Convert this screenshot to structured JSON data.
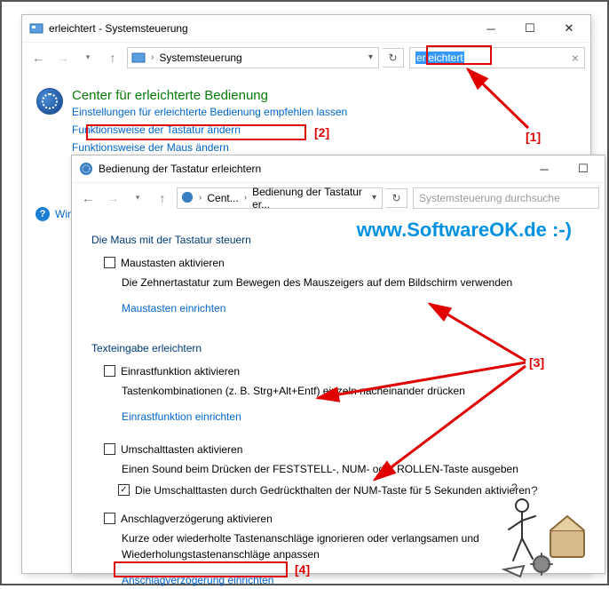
{
  "watermark": "www.SoftwareOK.de :-)",
  "window1": {
    "title": "erleichtert - Systemsteuerung",
    "breadcrumb": "Systemsteuerung",
    "search_value": "erleichtert",
    "heading": "Center für erleichterte Bedienung",
    "link_recommend": "Einstellungen für erleichterte Bedienung empfehlen lassen",
    "link_keyboard": "Funktionsweise der Tastatur ändern",
    "link_mouse": "Funktionsweise der Maus ändern",
    "help_link": "Windo"
  },
  "window2": {
    "title": "Bedienung der Tastatur erleichtern",
    "breadcrumb1": "Cent...",
    "breadcrumb2": "Bedienung der Tastatur er...",
    "search_placeholder": "Systemsteuerung durchsuche",
    "sec_mouse_title": "Die Maus mit der Tastatur steuern",
    "cb_mousekeys": "Maustasten aktivieren",
    "desc_mousekeys": "Die Zehnertastatur zum Bewegen des Mauszeigers auf dem Bildschirm verwenden",
    "link_mousekeys": "Maustasten einrichten",
    "sec_text_title": "Texteingabe erleichtern",
    "cb_sticky": "Einrastfunktion aktivieren",
    "desc_sticky": "Tastenkombinationen (z. B. Strg+Alt+Entf) einzeln nacheinander drücken",
    "link_sticky": "Einrastfunktion einrichten",
    "cb_toggle": "Umschalttasten aktivieren",
    "desc_toggle": "Einen Sound beim Drücken der FESTSTELL-, NUM- oder ROLLEN-Taste ausgeben",
    "cb_toggle_sub": "Die Umschalttasten durch Gedrückthalten der NUM-Taste für 5 Sekunden aktivieren",
    "cb_filter": "Anschlagverzögerung aktivieren",
    "desc_filter": "Kurze oder wiederholte Tastenanschläge ignorieren oder verlangsamen und Wiederholungstastenanschläge anpassen",
    "link_filter": "Anschlagverzögerung einrichten"
  },
  "annotations": {
    "a1": "[1]",
    "a2": "[2]",
    "a3": "[3]",
    "a4": "[4]"
  }
}
